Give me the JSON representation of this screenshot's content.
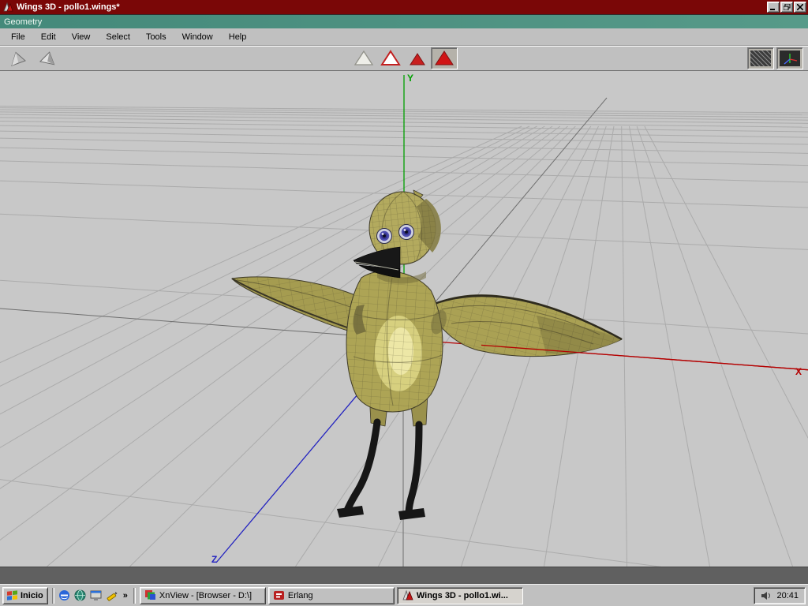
{
  "window": {
    "title": "Wings 3D - pollo1.wings*"
  },
  "geometry_bar": {
    "label": "Geometry"
  },
  "menu": {
    "items": [
      {
        "label": "File"
      },
      {
        "label": "Edit"
      },
      {
        "label": "View"
      },
      {
        "label": "Select"
      },
      {
        "label": "Tools"
      },
      {
        "label": "Window"
      },
      {
        "label": "Help"
      }
    ]
  },
  "toolbar": {
    "icons": [
      "undo-arrow-icon",
      "redo-arrow-icon",
      "vertex-select-mode-icon",
      "edge-select-mode-icon",
      "face-select-mode-icon",
      "body-select-mode-icon",
      "wireframe-shading-toggle-icon",
      "show-axes-toggle-icon"
    ]
  },
  "viewport": {
    "axis_labels": {
      "x": "X",
      "y": "Y",
      "z": "Z"
    }
  },
  "colors": {
    "titlebar": "#7a0707",
    "geometry_bar": "#4a8f7e",
    "axis_x": "#b40000",
    "axis_y": "#00a000",
    "axis_z": "#2222c0",
    "viewport_bg": "#c8c8c8",
    "model_body": "#ada455"
  },
  "taskbar": {
    "start_label": "Inicio",
    "overflow_chevron": "»",
    "tasks": [
      {
        "label": "XnView - [Browser - D:\\]"
      },
      {
        "label": "Erlang"
      },
      {
        "label": "Wings 3D - pollo1.wi..."
      }
    ],
    "clock": "20:41"
  }
}
